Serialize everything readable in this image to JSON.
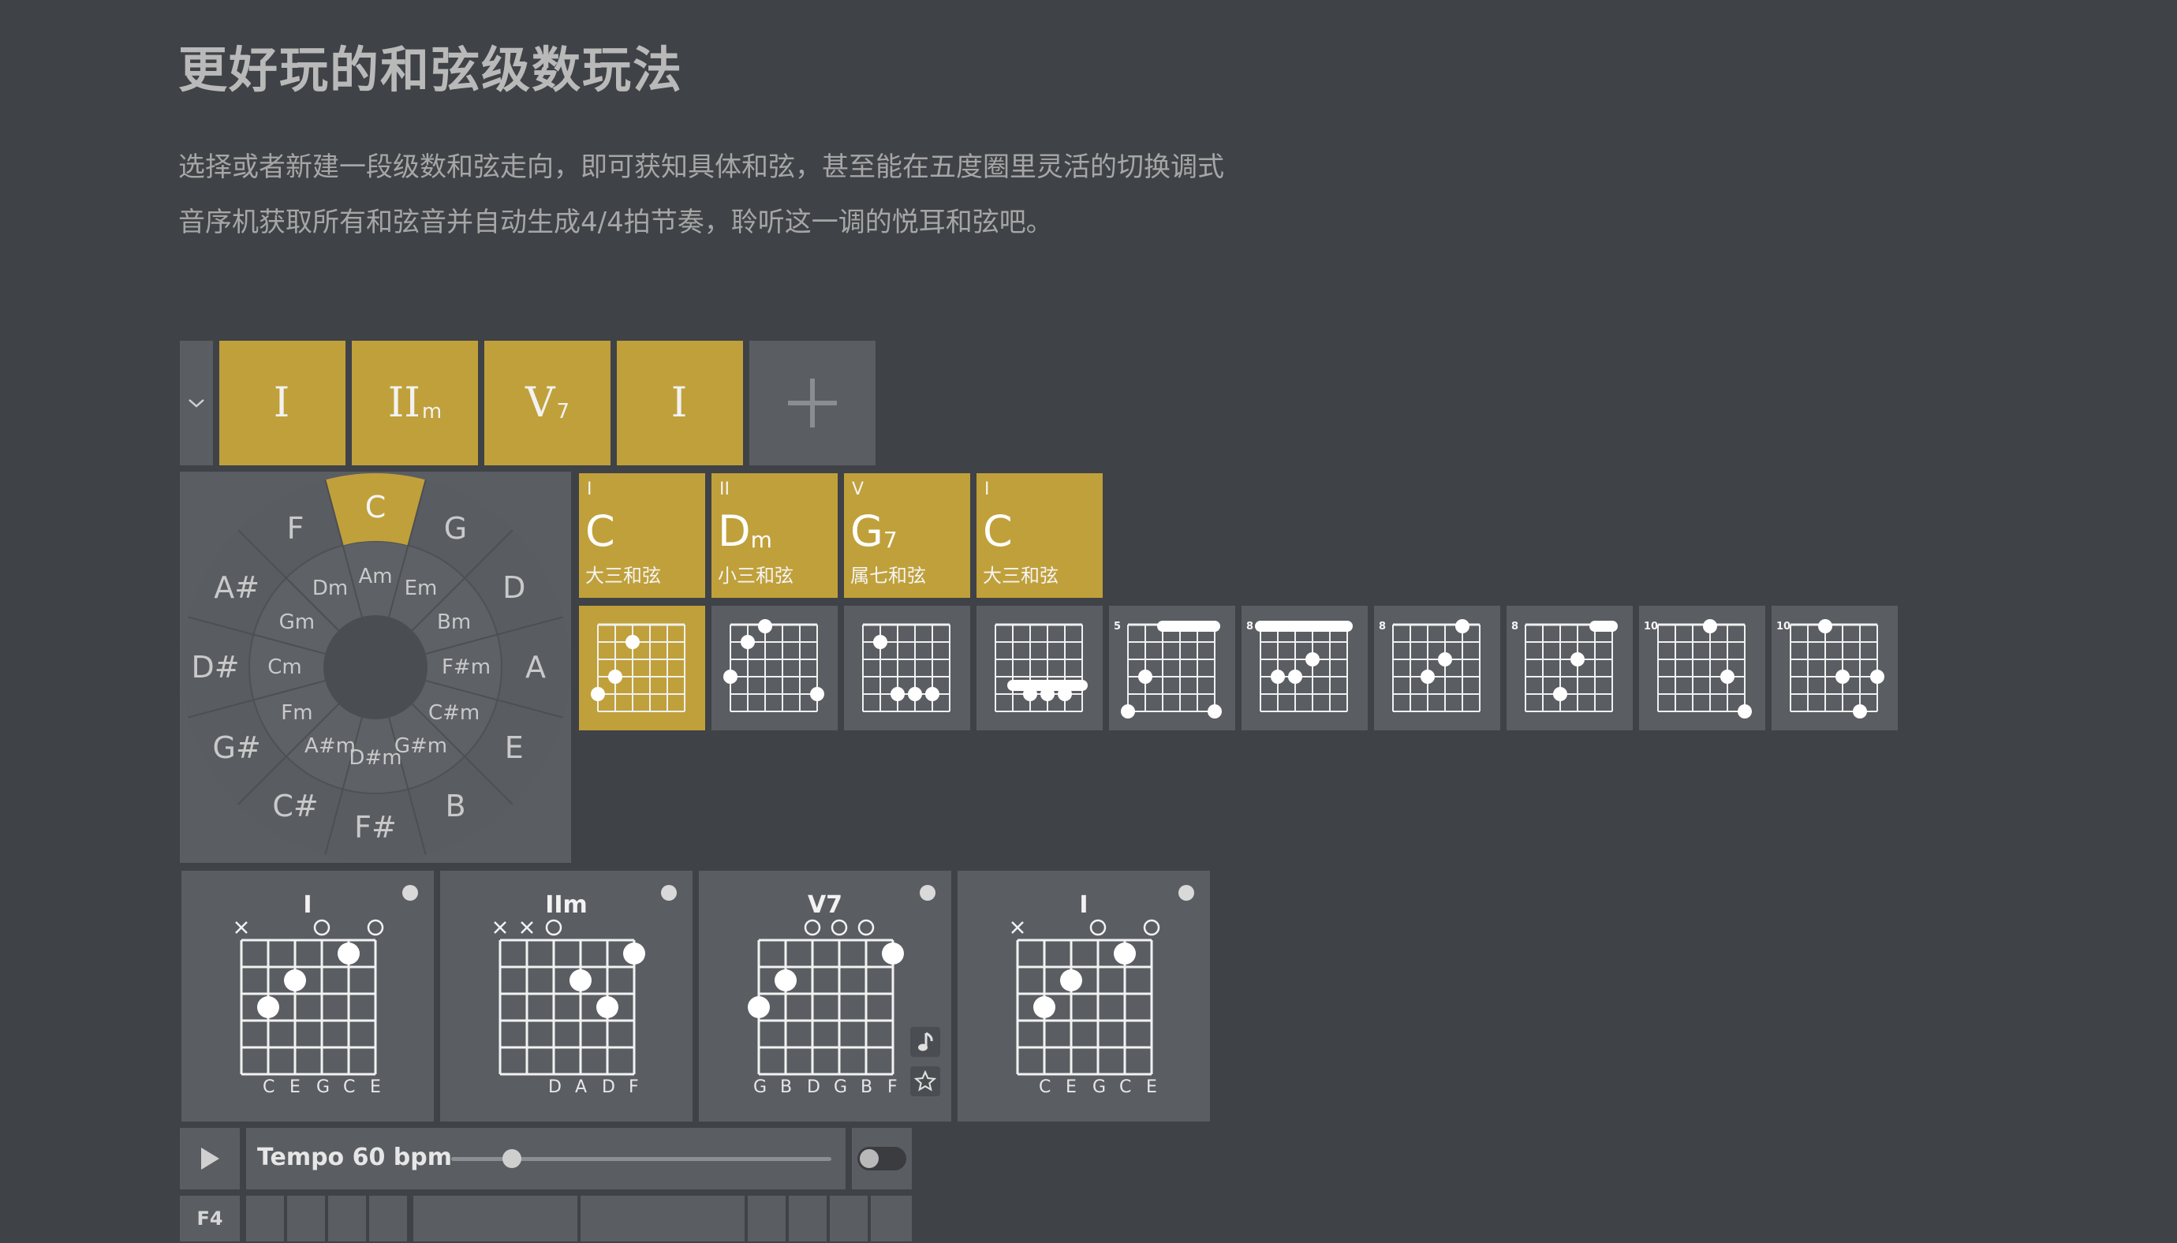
{
  "header": {
    "title": "更好玩的和弦级数玩法",
    "line1": "选择或者新建一段级数和弦走向，即可获知具体和弦，甚至能在五度圈里灵活的切换调式",
    "line2": "音序机获取所有和弦音并自动生成4/4拍节奏，聆听这一调的悦耳和弦吧。"
  },
  "progression": [
    {
      "main": "I",
      "sub": ""
    },
    {
      "main": "II",
      "sub": "m"
    },
    {
      "main": "V",
      "sub": "7"
    },
    {
      "main": "I",
      "sub": ""
    }
  ],
  "circle": {
    "selected": "C",
    "outer": [
      "C",
      "G",
      "D",
      "A",
      "E",
      "B",
      "F#",
      "C#",
      "G#",
      "D#",
      "A#",
      "F"
    ],
    "inner": [
      "Am",
      "Em",
      "Bm",
      "F#m",
      "C#m",
      "G#m",
      "D#m",
      "A#m",
      "Fm",
      "Cm",
      "Gm",
      "Dm"
    ]
  },
  "chord_cards": [
    {
      "roman": "I",
      "root": "C",
      "sub": "",
      "type": "大三和弦"
    },
    {
      "roman": "II",
      "root": "D",
      "sub": "m",
      "type": "小三和弦"
    },
    {
      "roman": "V",
      "root": "G",
      "sub": "7",
      "type": "属七和弦"
    },
    {
      "roman": "I",
      "root": "C",
      "sub": "",
      "type": "大三和弦"
    }
  ],
  "voicings": [
    {
      "fret": "",
      "barre": [],
      "dots": [
        [
          4,
          0
        ],
        [
          3,
          1
        ],
        [
          1,
          2
        ]
      ]
    },
    {
      "fret": "",
      "barre": [],
      "dots": [
        [
          3,
          0
        ],
        [
          1,
          1
        ],
        [
          0,
          2
        ],
        [
          4,
          5
        ]
      ]
    },
    {
      "fret": "",
      "barre": [],
      "dots": [
        [
          1,
          1
        ],
        [
          4,
          2
        ],
        [
          4,
          3
        ],
        [
          4,
          4
        ]
      ]
    },
    {
      "fret": "",
      "barre": [
        [
          3,
          1,
          5
        ]
      ],
      "dots": [
        [
          4,
          2
        ],
        [
          4,
          3
        ],
        [
          4,
          4
        ]
      ]
    },
    {
      "fret": "5",
      "barre": [
        [
          0,
          2,
          5
        ]
      ],
      "dots": [
        [
          5,
          0
        ],
        [
          3,
          1
        ],
        [
          5,
          5
        ]
      ]
    },
    {
      "fret": "8",
      "barre": [
        [
          0,
          0,
          5
        ]
      ],
      "dots": [
        [
          3,
          1
        ],
        [
          3,
          2
        ],
        [
          2,
          3
        ]
      ]
    },
    {
      "fret": "8",
      "barre": [],
      "dots": [
        [
          3,
          2
        ],
        [
          2,
          3
        ],
        [
          0,
          4
        ]
      ]
    },
    {
      "fret": "8",
      "barre": [
        [
          0,
          4,
          5
        ]
      ],
      "dots": [
        [
          4,
          2
        ],
        [
          2,
          3
        ]
      ]
    },
    {
      "fret": "10",
      "barre": [],
      "dots": [
        [
          0,
          3
        ],
        [
          3,
          4
        ],
        [
          5,
          5
        ]
      ]
    },
    {
      "fret": "10",
      "barre": [],
      "dots": [
        [
          0,
          2
        ],
        [
          3,
          3
        ],
        [
          5,
          4
        ],
        [
          3,
          5
        ]
      ]
    }
  ],
  "big_cards": [
    {
      "title": "I",
      "markers": [
        "×",
        "",
        "",
        "○",
        "",
        "○"
      ],
      "notes": [
        "C",
        "E",
        "G",
        "C",
        "E"
      ],
      "dots": [
        [
          2,
          1
        ],
        [
          1,
          2
        ],
        [
          0,
          4
        ]
      ]
    },
    {
      "title": "IIm",
      "markers": [
        "×",
        "×",
        "○",
        "",
        "",
        ""
      ],
      "notes": [
        "D",
        "A",
        "D",
        "F"
      ],
      "dots": [
        [
          1,
          3
        ],
        [
          2,
          4
        ],
        [
          0,
          5
        ]
      ]
    },
    {
      "title": "V7",
      "markers": [
        "",
        "",
        "○",
        "○",
        "○",
        ""
      ],
      "notes": [
        "G",
        "B",
        "D",
        "G",
        "B",
        "F"
      ],
      "dots": [
        [
          2,
          0
        ],
        [
          1,
          1
        ],
        [
          0,
          5
        ]
      ]
    },
    {
      "title": "I",
      "markers": [
        "×",
        "",
        "",
        "○",
        "",
        "○"
      ],
      "notes": [
        "C",
        "E",
        "G",
        "C",
        "E"
      ],
      "dots": [
        [
          2,
          1
        ],
        [
          1,
          2
        ],
        [
          0,
          4
        ]
      ]
    }
  ],
  "player": {
    "tempo_label": "Tempo 60 bpm",
    "tempo_fraction": 0.16,
    "row_label": "F4"
  },
  "colors": {
    "gold": "#c0a03a",
    "tile": "#5a5d62",
    "bg": "#3f4246"
  }
}
